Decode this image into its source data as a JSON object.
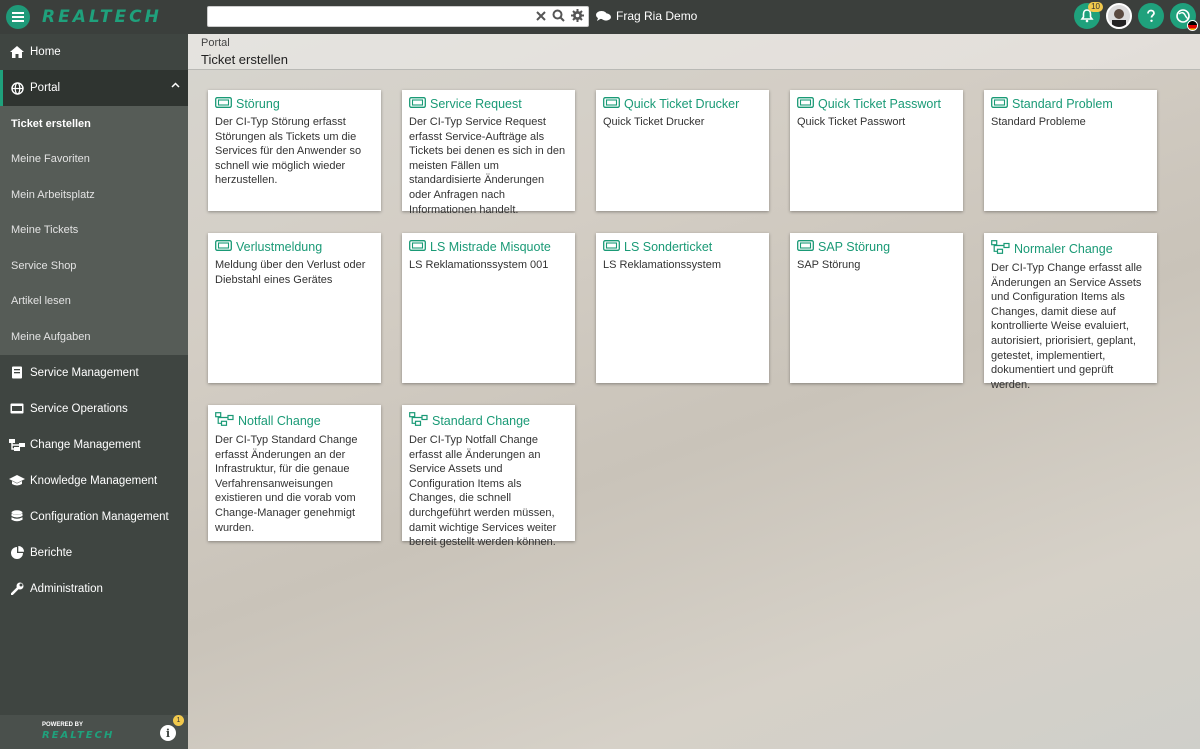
{
  "app": {
    "logo": "REALTECH"
  },
  "search": {
    "value": "",
    "placeholder": ""
  },
  "chat": {
    "label": "Frag Ria Demo"
  },
  "notifications": {
    "count": "10"
  },
  "sidebar": {
    "home": "Home",
    "portal": "Portal",
    "portal_sub": [
      "Ticket erstellen",
      "Meine Favoriten",
      "Mein Arbeitsplatz",
      "Meine Tickets",
      "Service Shop",
      "Artikel lesen",
      "Meine Aufgaben"
    ],
    "modules": [
      "Service Management",
      "Service Operations",
      "Change Management",
      "Knowledge Management",
      "Configuration Management",
      "Berichte",
      "Administration"
    ],
    "footer": {
      "powered": "POWERED BY",
      "logo": "REALTECH",
      "info_count": "1"
    }
  },
  "breadcrumb": "Portal",
  "page_title": "Ticket erstellen",
  "cards": [
    {
      "title": "Störung",
      "desc": "Der CI-Typ Störung erfasst Störungen als Tickets um die Services für den Anwender so schnell wie möglich wieder herzustellen.",
      "icon": "ticket-icon"
    },
    {
      "title": "Service Request",
      "desc": "Der CI-Typ Service Request erfasst Service-Aufträge als Tickets bei denen es sich in den meisten Fällen um standardisierte Änderungen oder Anfragen nach Informationen handelt.",
      "icon": "ticket-icon"
    },
    {
      "title": "Quick Ticket Drucker",
      "desc": "Quick Ticket Drucker",
      "icon": "ticket-icon"
    },
    {
      "title": "Quick Ticket Passwort",
      "desc": "Quick Ticket Passwort",
      "icon": "ticket-icon"
    },
    {
      "title": "Standard Problem",
      "desc": "Standard Probleme",
      "icon": "ticket-icon"
    },
    {
      "title": "Verlustmeldung",
      "desc": "Meldung über den Verlust oder Diebstahl eines Gerätes",
      "icon": "ticket-icon"
    },
    {
      "title": "LS Mistrade Misquote",
      "desc": "LS Reklamationssystem 001",
      "icon": "ticket-icon"
    },
    {
      "title": "LS Sonderticket",
      "desc": "LS Reklamationssystem",
      "icon": "ticket-icon"
    },
    {
      "title": "SAP Störung",
      "desc": "SAP Störung",
      "icon": "ticket-icon"
    },
    {
      "title": "Normaler Change",
      "desc": "Der CI-Typ Change erfasst alle Änderungen an Service Assets und Configuration Items als Changes, damit diese auf kontrollierte Weise evaluiert, autorisiert, priorisiert, geplant, getestet, implementiert, dokumentiert und geprüft werden.",
      "icon": "change-icon"
    },
    {
      "title": "Notfall Change",
      "desc": "Der CI-Typ Standard Change erfasst Änderungen an der Infrastruktur, für die genaue Verfahrensanweisungen existieren und die vorab vom Change-Manager genehmigt wurden.",
      "icon": "change-icon"
    },
    {
      "title": "Standard Change",
      "desc": "Der CI-Typ Notfall Change erfasst alle Änderungen an Service Assets und Configuration Items als Changes, die schnell durchgeführt werden müssen, damit wichtige Services weiter bereit gestellt werden können.",
      "icon": "change-icon"
    }
  ]
}
